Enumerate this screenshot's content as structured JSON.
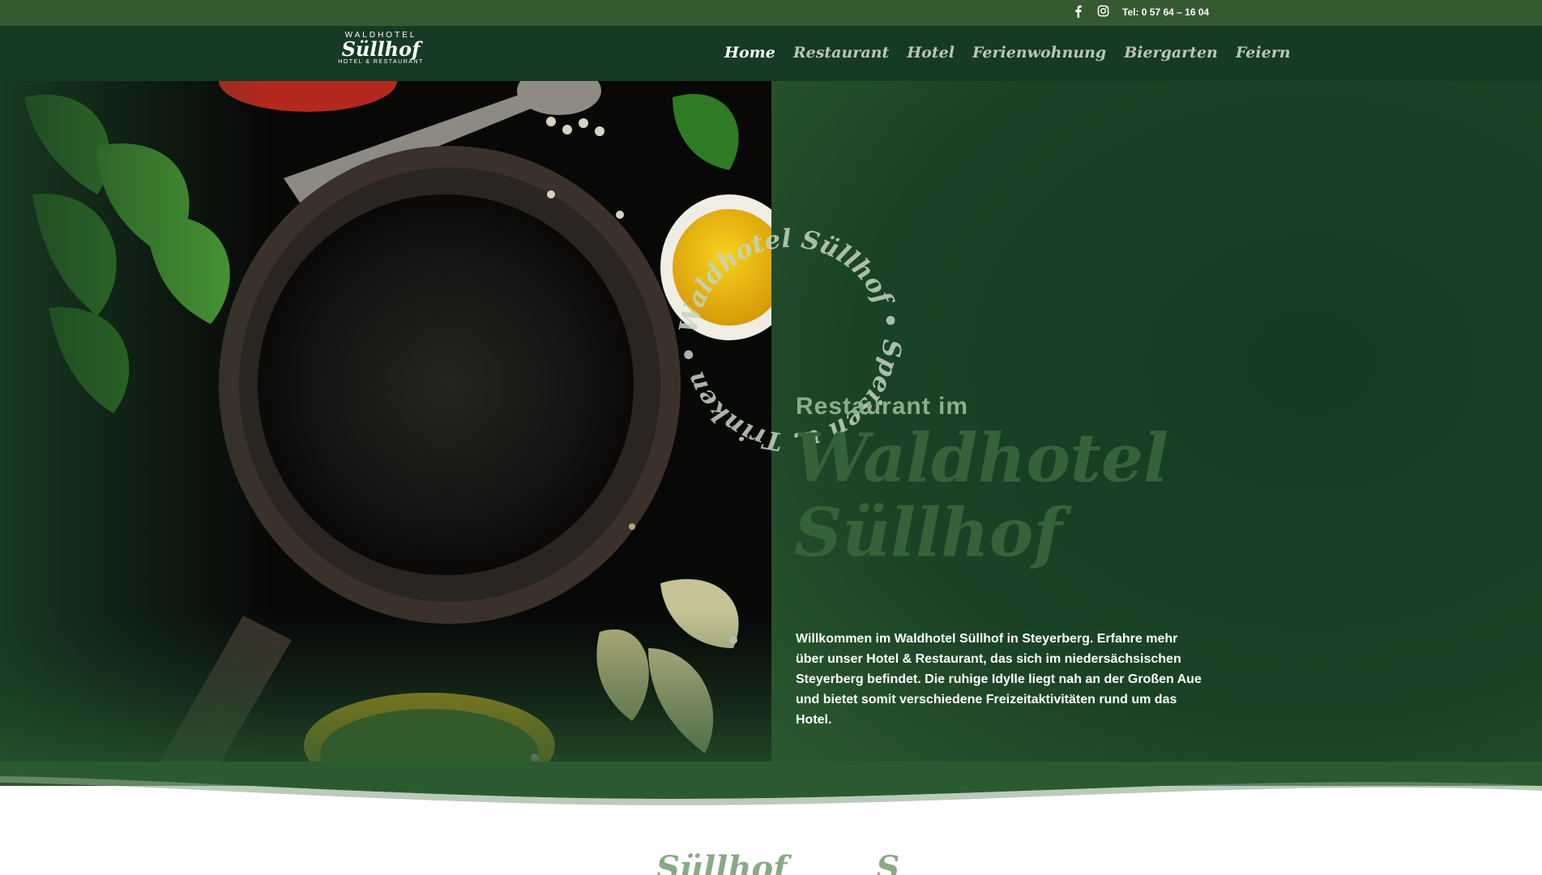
{
  "topbar": {
    "phone": "Tel: 0 57 64 – 16 04",
    "social": [
      "facebook-icon",
      "instagram-icon"
    ]
  },
  "logo": {
    "top": "WALDHOTEL",
    "main": "Süllhof",
    "bottom": "HOTEL & RESTAURANT"
  },
  "nav": {
    "items": [
      "Home",
      "Restaurant",
      "Hotel",
      "Ferienwohnung",
      "Biergarten",
      "Feiern"
    ],
    "active": "Home"
  },
  "hero": {
    "circular_text": "Waldhotel Süllhof • Speisen u. Trinken •",
    "subtitle": "Restaurant im",
    "title_line1": "Waldhotel",
    "title_line2": "Süllhof",
    "text": "Willkommen im Waldhotel Süllhof in Steyerberg. Erfahre mehr über unser Hotel & Restaurant, das sich im niedersächsischen Steyerberg befindet. Die ruhige Idylle liegt nah an der Großen Aue und bietet somit verschiedene Freizeitaktivitäten rund um das Hotel."
  },
  "below": {
    "script_left": "Süllhof",
    "script_right": "S"
  },
  "colors": {
    "topbar": "#355a32",
    "nav": "#163a22",
    "hero": "#163a22",
    "title": "#36623a",
    "subtitle": "#8fac8a"
  }
}
